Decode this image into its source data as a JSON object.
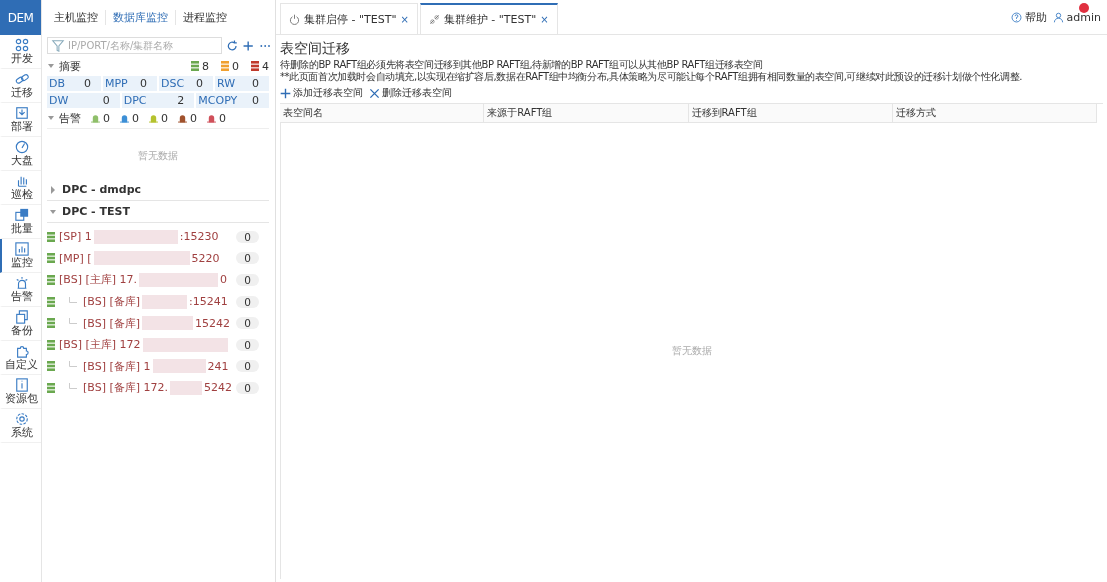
{
  "app": {
    "logo": "DEM"
  },
  "nav": [
    {
      "label": "开发",
      "selected": false
    },
    {
      "label": "迁移",
      "selected": false
    },
    {
      "label": "部署",
      "selected": false
    },
    {
      "label": "大盘",
      "selected": false
    },
    {
      "label": "巡检",
      "selected": false
    },
    {
      "label": "批量",
      "selected": false
    },
    {
      "label": "监控",
      "selected": true
    },
    {
      "label": "告警",
      "selected": false
    },
    {
      "label": "备份",
      "selected": false
    },
    {
      "label": "自定义",
      "selected": false
    },
    {
      "label": "资源包",
      "selected": false
    },
    {
      "label": "系统",
      "selected": false
    }
  ],
  "panel_tabs": [
    {
      "label": "主机监控",
      "selected": false
    },
    {
      "label": "数据库监控",
      "selected": true
    },
    {
      "label": "进程监控",
      "selected": false
    }
  ],
  "search": {
    "placeholder": "IP/PORT/名称/集群名称"
  },
  "summary": {
    "title": "摘要",
    "expanded": true,
    "status_counts": [
      {
        "color": "#6aa84f",
        "count": "8"
      },
      {
        "color": "#f0a030",
        "count": "0"
      },
      {
        "color": "#c0392b",
        "count": "4"
      }
    ],
    "types": [
      [
        {
          "name": "DB",
          "count": "0"
        },
        {
          "name": "MPP",
          "count": "0"
        },
        {
          "name": "DSC",
          "count": "0"
        },
        {
          "name": "RW",
          "count": "0"
        }
      ],
      [
        {
          "name": "DW",
          "count": "0"
        },
        {
          "name": "DPC",
          "count": "2"
        },
        {
          "name": "MCOPY",
          "count": "0"
        }
      ]
    ]
  },
  "alarms": {
    "title": "告警",
    "expanded": true,
    "levels": [
      {
        "color": "#8fbf6a",
        "count": "0"
      },
      {
        "color": "#3d8fd6",
        "count": "0"
      },
      {
        "color": "#b5c22e",
        "count": "0"
      },
      {
        "color": "#a0522d",
        "count": "0"
      },
      {
        "color": "#d0505a",
        "count": "0"
      }
    ],
    "empty": "暂无数据"
  },
  "groups": [
    {
      "title": "DPC - dmdpc",
      "expanded": false
    },
    {
      "title": "DPC - TEST",
      "expanded": true,
      "nodes": [
        {
          "prefix": "[SP] 1",
          "suffix": ":15230",
          "count": "0"
        },
        {
          "prefix": "[MP] [",
          "suffix": "5220",
          "count": "0"
        },
        {
          "prefix": "[BS] [主库] 17.",
          "suffix": "0",
          "count": "0",
          "children": [
            {
              "prefix": "[BS] [备库]",
              "suffix": ":15241",
              "count": "0"
            },
            {
              "prefix": "[BS] [备库]",
              "suffix": "15242",
              "count": "0"
            }
          ]
        },
        {
          "prefix": "[BS] [主库] 172",
          "count": "0",
          "children": [
            {
              "prefix": "[BS] [备库] 1",
              "suffix": "241",
              "count": "0"
            },
            {
              "prefix": "[BS] [备库] 172.",
              "suffix": "5242",
              "count": "0"
            }
          ]
        }
      ]
    }
  ],
  "tabs": [
    {
      "label": "集群启停 - \"TEST\"",
      "selected": false,
      "close": "×"
    },
    {
      "label": "集群维护 - \"TEST\"",
      "selected": true,
      "close": "×"
    }
  ],
  "topbar": {
    "help": "帮助",
    "user": "admin",
    "notification": true
  },
  "page": {
    "title": "表空间迁移",
    "notes": [
      "待删除的BP RAFT组必须先将表空间迁移到其他BP RAFT组,待新增的BP RAFT组可以从其他BP RAFT组迁移表空间",
      "**此页面首次加载时会自动填充,以实现在缩扩容后,数据在RAFT组中均衡分布,具体策略为尽可能让每个RAFT组拥有相同数量的表空间,可继续对此预设的迁移计划做个性化调整."
    ],
    "actions": [
      {
        "label": "添加迁移表空间",
        "kind": "add"
      },
      {
        "label": "删除迁移表空间",
        "kind": "delete"
      }
    ],
    "table": {
      "columns": [
        "表空间名",
        "来源于RAFT组",
        "迁移到RAFT组",
        "迁移方式"
      ],
      "empty": "暂无数据"
    }
  }
}
